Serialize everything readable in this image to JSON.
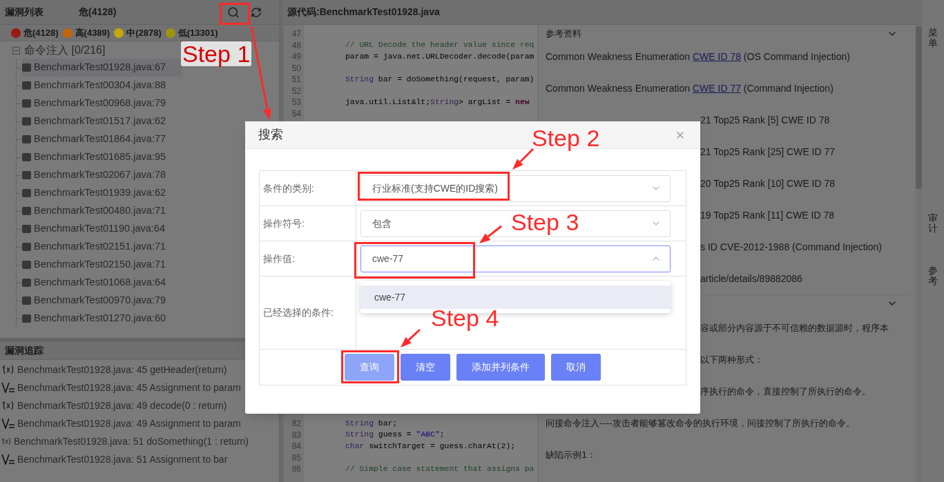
{
  "vuln_list": {
    "title": "漏洞列表",
    "summary": "危(4128)",
    "severity": [
      {
        "label": "危(4128)",
        "color": "#9c1a12"
      },
      {
        "label": "高(4389)",
        "color": "#c0650c"
      },
      {
        "label": "中(2878)",
        "color": "#c4a80a"
      },
      {
        "label": "低(13301)",
        "color": "#9e940a"
      }
    ],
    "tree": [
      {
        "label": "命令注入 [0/216]",
        "expanded": true,
        "children": [
          {
            "label": "BenchmarkTest01928.java:67",
            "selected": true
          },
          {
            "label": "BenchmarkTest00304.java:88",
            "selected": false
          },
          {
            "label": "BenchmarkTest00968.java:79",
            "selected": false
          },
          {
            "label": "BenchmarkTest01517.java:62",
            "selected": false
          },
          {
            "label": "BenchmarkTest01864.java:77",
            "selected": false
          },
          {
            "label": "BenchmarkTest01685.java:95",
            "selected": false
          },
          {
            "label": "BenchmarkTest02067.java:78",
            "selected": false
          },
          {
            "label": "BenchmarkTest01939.java:62",
            "selected": false
          },
          {
            "label": "BenchmarkTest00480.java:71",
            "selected": false
          },
          {
            "label": "BenchmarkTest01190.java:64",
            "selected": false
          },
          {
            "label": "BenchmarkTest02151.java:71",
            "selected": false
          },
          {
            "label": "BenchmarkTest02150.java:71",
            "selected": false
          },
          {
            "label": "BenchmarkTest01068.java:64",
            "selected": false
          },
          {
            "label": "BenchmarkTest00970.java:79",
            "selected": false
          },
          {
            "label": "BenchmarkTest01270.java:60",
            "selected": false
          }
        ]
      }
    ]
  },
  "trace": {
    "title": "漏洞追踪",
    "rows": [
      {
        "kind": "call",
        "text": "BenchmarkTest01928.java: 45 getHeader(return)"
      },
      {
        "kind": "assign",
        "text": "BenchmarkTest01928.java: 45 Assignment to param"
      },
      {
        "kind": "call",
        "text": "BenchmarkTest01928.java: 49 decode(0 : return)"
      },
      {
        "kind": "assign",
        "text": "BenchmarkTest01928.java: 49 Assignment to param"
      },
      {
        "kind": "call",
        "text": "BenchmarkTest01928.java: 51 doSomething(1 : return)"
      },
      {
        "kind": "assign",
        "text": "BenchmarkTest01928.java: 51 Assignment to bar"
      }
    ]
  },
  "source": {
    "title": "源代码:BenchmarkTest01928.java",
    "lines_top": [
      {
        "number": "47"
      },
      {
        "number": "48",
        "tokens": [
          {
            "kind": "comment",
            "text": "// URL Decode the header value since req"
          }
        ]
      },
      {
        "number": "49",
        "tokens": [
          {
            "kind": "plain",
            "text": "param = java.net.URLDecoder.decode(param"
          }
        ]
      },
      {
        "number": "50"
      },
      {
        "number": "51",
        "tokens": [
          {
            "kind": "type",
            "text": "String"
          },
          {
            "kind": "plain",
            "text": " bar = doSomething(request, param)"
          }
        ]
      },
      {
        "number": "52"
      },
      {
        "number": "53",
        "tokens": [
          {
            "kind": "plain",
            "text": "java.util.List&lt;"
          },
          {
            "kind": "type",
            "text": "String"
          },
          {
            "kind": "plain",
            "text": "> argList = "
          },
          {
            "kind": "keyword",
            "text": "new"
          }
        ]
      },
      {
        "number": "54"
      }
    ],
    "lines_bottom": [
      {
        "number": "82",
        "tokens": [
          {
            "kind": "type",
            "text": "String"
          },
          {
            "kind": "plain",
            "text": " bar;"
          }
        ]
      },
      {
        "number": "83",
        "tokens": [
          {
            "kind": "type",
            "text": "String"
          },
          {
            "kind": "plain",
            "text": " guess = "
          },
          {
            "kind": "string",
            "text": "\"ABC\""
          },
          {
            "kind": "plain",
            "text": ";"
          }
        ]
      },
      {
        "number": "84",
        "tokens": [
          {
            "kind": "type",
            "text": "char"
          },
          {
            "kind": "plain",
            "text": " switchTarget = guess.charAt(2);"
          }
        ]
      },
      {
        "number": "85"
      },
      {
        "number": "86",
        "tokens": [
          {
            "kind": "comment",
            "text": "// Simple case statement that assigns pa"
          }
        ]
      }
    ]
  },
  "references": {
    "title": "参考资料",
    "items": [
      {
        "kind": "full",
        "segments": [
          {
            "text": "Common Weakness Enumeration "
          },
          {
            "text": "CWE ID 78",
            "link": true
          },
          {
            "text": " (OS Command Injection)"
          }
        ]
      },
      {
        "kind": "full",
        "segments": [
          {
            "text": "Common Weakness Enumeration "
          },
          {
            "text": "CWE ID 77",
            "link": true
          },
          {
            "text": " (Command Injection)"
          }
        ]
      },
      {
        "kind": "tail",
        "segments": [
          {
            "text": "21 Top25 Rank [5] CWE ID 78"
          }
        ]
      },
      {
        "kind": "tail",
        "segments": [
          {
            "text": "21 Top25 Rank [25] CWE ID 77"
          }
        ]
      },
      {
        "kind": "tail",
        "segments": [
          {
            "text": "20 Top25 Rank [10] CWE ID 78"
          }
        ]
      },
      {
        "kind": "tail",
        "segments": [
          {
            "text": "19 Top25 Rank [11] CWE ID 78"
          }
        ]
      },
      {
        "kind": "tail",
        "segments": [
          {
            "text": "s ID CVE-2012-1988 (Command Injection)"
          }
        ]
      },
      {
        "kind": "tail",
        "segments": [
          {
            "text": "article/details/89882086"
          }
        ]
      }
    ]
  },
  "description": {
    "lines": [
      {
        "kind": "tail",
        "text": "容或部分内容源于不可信赖的数据源时，程序本"
      },
      {
        "kind": "tail",
        "text": "以下两种形式："
      },
      {
        "kind": "tail",
        "text": "序执行的命令，直接控制了所执行的命令。"
      },
      {
        "kind": "full",
        "text": "间接命令注入----攻击者能够篡改命令的执行环境，间接控制了所执行的命令。"
      },
      {
        "kind": "full",
        "text": "缺陷示例1："
      }
    ]
  },
  "side_tabs": [
    {
      "label": "菜单"
    },
    {
      "label": "审计"
    },
    {
      "label": "参考"
    }
  ],
  "dialog": {
    "title": "搜索",
    "fields": [
      {
        "label": "条件的类别:",
        "value": "行业标准(支持CWE的ID搜索)",
        "open": false
      },
      {
        "label": "操作符号:",
        "value": "包含",
        "open": false
      },
      {
        "label": "操作值:",
        "value": "cwe-77",
        "open": true
      }
    ],
    "conditions_label": "已经选择的条件:",
    "suggestions": [
      {
        "label": "cwe-77",
        "selected": true
      }
    ],
    "buttons": [
      {
        "label": "查询",
        "disabled": true
      },
      {
        "label": "清空",
        "disabled": false
      },
      {
        "label": "添加并列条件",
        "disabled": false
      },
      {
        "label": "取消",
        "disabled": false
      }
    ]
  },
  "annotations": [
    {
      "label": "Step 1"
    },
    {
      "label": "Step 2"
    },
    {
      "label": "Step 3"
    },
    {
      "label": "Step 4"
    }
  ]
}
